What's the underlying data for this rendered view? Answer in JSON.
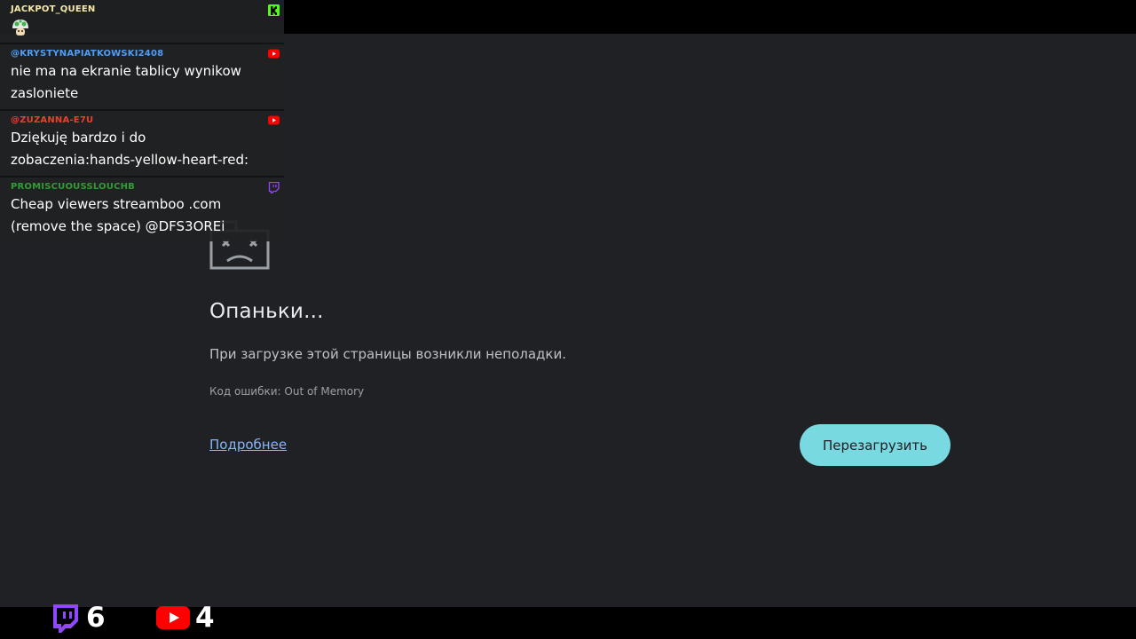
{
  "chat": {
    "messages": [
      {
        "user": "JACKPOT_QUEEN",
        "text": "",
        "platform": "kick-icon",
        "user_color": "#f6e9a8",
        "emote": "mushroom-emote-icon"
      },
      {
        "user": "@KRYSTYNAPIATKOWSKI2408",
        "text": "nie ma na ekranie tablicy wynikow\nzasloniete",
        "platform": "youtube-icon",
        "user_color": "#4e9ef5"
      },
      {
        "user": "@ZUZANNA-E7U",
        "text": "Dziękuję bardzo i do\nzobaczenia:hands-yellow-heart-red:",
        "platform": "youtube-icon",
        "user_color": "#e8412c"
      },
      {
        "user": "PROMISCUOUSSLOUCHB",
        "text": "Cheap viewers streamboo .com\n(remove the space) @DFS3OREi",
        "platform": "twitch-icon",
        "user_color": "#2f9e32"
      }
    ]
  },
  "error_page": {
    "title": "Опаньки...",
    "message": "При загрузке этой страницы возникли неполадки.",
    "error_code": "Код ошибки: Out of Memory",
    "more_link": "Подробнее",
    "reload_button": "Перезагрузить",
    "accent_color": "#78d9e0"
  },
  "viewers": {
    "twitch": "6",
    "youtube": "4"
  }
}
